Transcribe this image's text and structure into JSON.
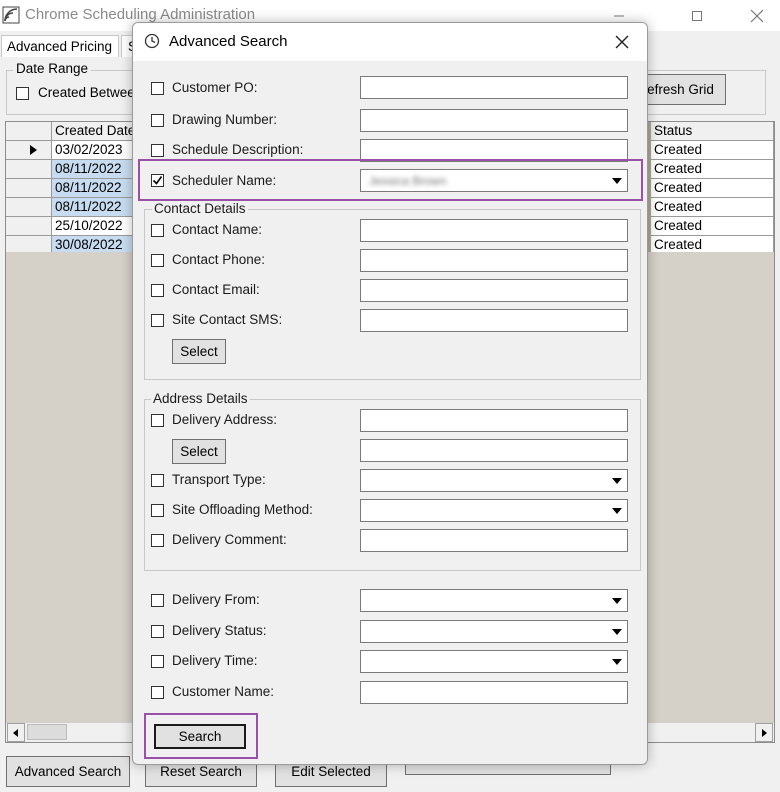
{
  "main_window": {
    "title": "Chrome Scheduling Administration",
    "tabs": [
      "Advanced Pricing",
      "S"
    ],
    "date_range": {
      "legend": "Date Range",
      "created_between_label": "Created Betwee"
    },
    "refresh_grid_label": "efresh Grid",
    "grid": {
      "headers": {
        "created_date": "Created Date",
        "status": "Status"
      },
      "rows": [
        {
          "created_date": "03/02/2023",
          "status": "Created"
        },
        {
          "created_date": "08/11/2022",
          "status": "Created"
        },
        {
          "created_date": "08/11/2022",
          "status": "Created"
        },
        {
          "created_date": "08/11/2022",
          "status": "Created"
        },
        {
          "created_date": "25/10/2022",
          "status": "Created"
        },
        {
          "created_date": "30/08/2022",
          "status": "Created"
        }
      ]
    },
    "bottom_buttons": {
      "advanced_search": "Advanced Search",
      "reset_search": "Reset Search",
      "edit_selected": "Edit Selected"
    }
  },
  "dialog": {
    "title": "Advanced Search",
    "fields": {
      "customer_po": {
        "label": "Customer PO:",
        "checked": false,
        "value": ""
      },
      "drawing_number": {
        "label": "Drawing Number:",
        "checked": false,
        "value": ""
      },
      "schedule_description": {
        "label": "Schedule Description:",
        "checked": false,
        "value": ""
      },
      "scheduler_name": {
        "label": "Scheduler Name:",
        "checked": true,
        "value": "Jessica Brown"
      }
    },
    "contact_details": {
      "legend": "Contact Details",
      "contact_name": {
        "label": "Contact Name:",
        "checked": false,
        "value": ""
      },
      "contact_phone": {
        "label": "Contact Phone:",
        "checked": false,
        "value": ""
      },
      "contact_email": {
        "label": "Contact Email:",
        "checked": false,
        "value": ""
      },
      "site_contact_sms": {
        "label": "Site Contact SMS:",
        "checked": false,
        "value": ""
      },
      "select_label": "Select"
    },
    "address_details": {
      "legend": "Address Details",
      "delivery_address": {
        "label": "Delivery Address:",
        "checked": false,
        "value": ""
      },
      "select_label": "Select",
      "transport_type": {
        "label": "Transport Type:",
        "checked": false,
        "value": ""
      },
      "site_offloading_method": {
        "label": "Site Offloading Method:",
        "checked": false,
        "value": ""
      },
      "delivery_comment": {
        "label": "Delivery Comment:",
        "checked": false,
        "value": ""
      }
    },
    "delivery": {
      "delivery_from": {
        "label": "Delivery From:",
        "checked": false,
        "value": ""
      },
      "delivery_status": {
        "label": "Delivery Status:",
        "checked": false,
        "value": ""
      },
      "delivery_time": {
        "label": "Delivery Time:",
        "checked": false,
        "value": ""
      },
      "customer_name": {
        "label": "Customer Name:",
        "checked": false,
        "value": ""
      }
    },
    "search_label": "Search"
  },
  "colors": {
    "highlight": "#9b4fa8",
    "selected_row": "#c7dcf0",
    "grid_background": "#d5d0c8"
  }
}
